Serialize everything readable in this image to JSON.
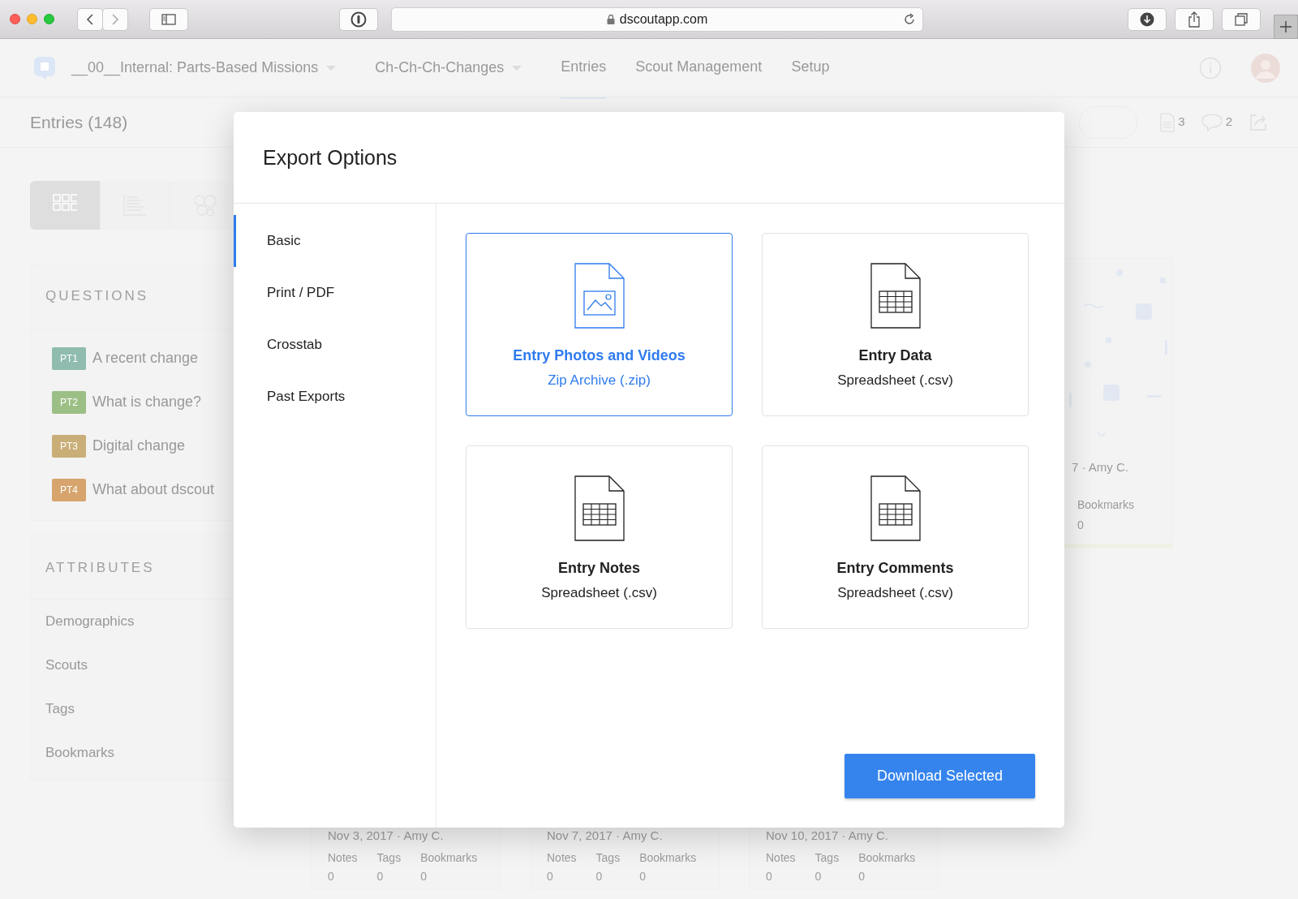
{
  "browser": {
    "url": "dscoutapp.com"
  },
  "nav": {
    "project": "__00__Internal: Parts-Based Missions",
    "mission": "Ch-Ch-Ch-Changes",
    "links": [
      {
        "label": "Entries",
        "selected": true
      },
      {
        "label": "Scout Management",
        "selected": false
      },
      {
        "label": "Setup",
        "selected": false
      }
    ]
  },
  "header": {
    "title": "Entries (148)",
    "counts": [
      {
        "kind": "document",
        "value": "3"
      },
      {
        "kind": "comment",
        "value": "2"
      }
    ]
  },
  "view_toggle": [
    {
      "kind": "grid",
      "selected": true
    },
    {
      "kind": "list",
      "selected": false
    },
    {
      "kind": "cluster",
      "selected": false
    }
  ],
  "questions": {
    "title": "QUESTIONS",
    "items": [
      {
        "tag": "PT1",
        "text": "A recent change",
        "color": "#8fbcae"
      },
      {
        "tag": "PT2",
        "text": "What is change?",
        "color": "#9cbf85"
      },
      {
        "tag": "PT3",
        "text": "Digital change",
        "color": "#c9ae78"
      },
      {
        "tag": "PT4",
        "text": "What about dscout",
        "color": "#d6a46c"
      }
    ]
  },
  "attributes": {
    "title": "ATTRIBUTES",
    "items": [
      "Demographics",
      "Scouts",
      "Tags",
      "Bookmarks"
    ]
  },
  "side_card": {
    "meta": "7 · Amy C.",
    "stat_label": "Bookmarks",
    "stat_value": "0"
  },
  "entry_cards": [
    {
      "meta": "Nov 3, 2017 · Amy C.",
      "stats": [
        {
          "label": "Notes",
          "value": "0"
        },
        {
          "label": "Tags",
          "value": "0"
        },
        {
          "label": "Bookmarks",
          "value": "0"
        }
      ]
    },
    {
      "meta": "Nov 7, 2017 · Amy C.",
      "stats": [
        {
          "label": "Notes",
          "value": "0"
        },
        {
          "label": "Tags",
          "value": "0"
        },
        {
          "label": "Bookmarks",
          "value": "0"
        }
      ]
    },
    {
      "meta": "Nov 10, 2017 · Amy C.",
      "stats": [
        {
          "label": "Notes",
          "value": "0"
        },
        {
          "label": "Tags",
          "value": "0"
        },
        {
          "label": "Bookmarks",
          "value": "0"
        }
      ]
    }
  ],
  "modal": {
    "title": "Export Options",
    "menu": [
      {
        "label": "Basic",
        "selected": true
      },
      {
        "label": "Print / PDF",
        "selected": false
      },
      {
        "label": "Crosstab",
        "selected": false
      },
      {
        "label": "Past Exports",
        "selected": false
      }
    ],
    "options": [
      {
        "kind": "image",
        "title": "Entry Photos and Videos",
        "subtitle": "Zip Archive (.zip)",
        "selected": true
      },
      {
        "kind": "table",
        "title": "Entry Data",
        "subtitle": "Spreadsheet (.csv)",
        "selected": false
      },
      {
        "kind": "table",
        "title": "Entry Notes",
        "subtitle": "Spreadsheet (.csv)",
        "selected": false
      },
      {
        "kind": "table",
        "title": "Entry Comments",
        "subtitle": "Spreadsheet (.csv)",
        "selected": false
      }
    ],
    "button": "Download Selected"
  }
}
